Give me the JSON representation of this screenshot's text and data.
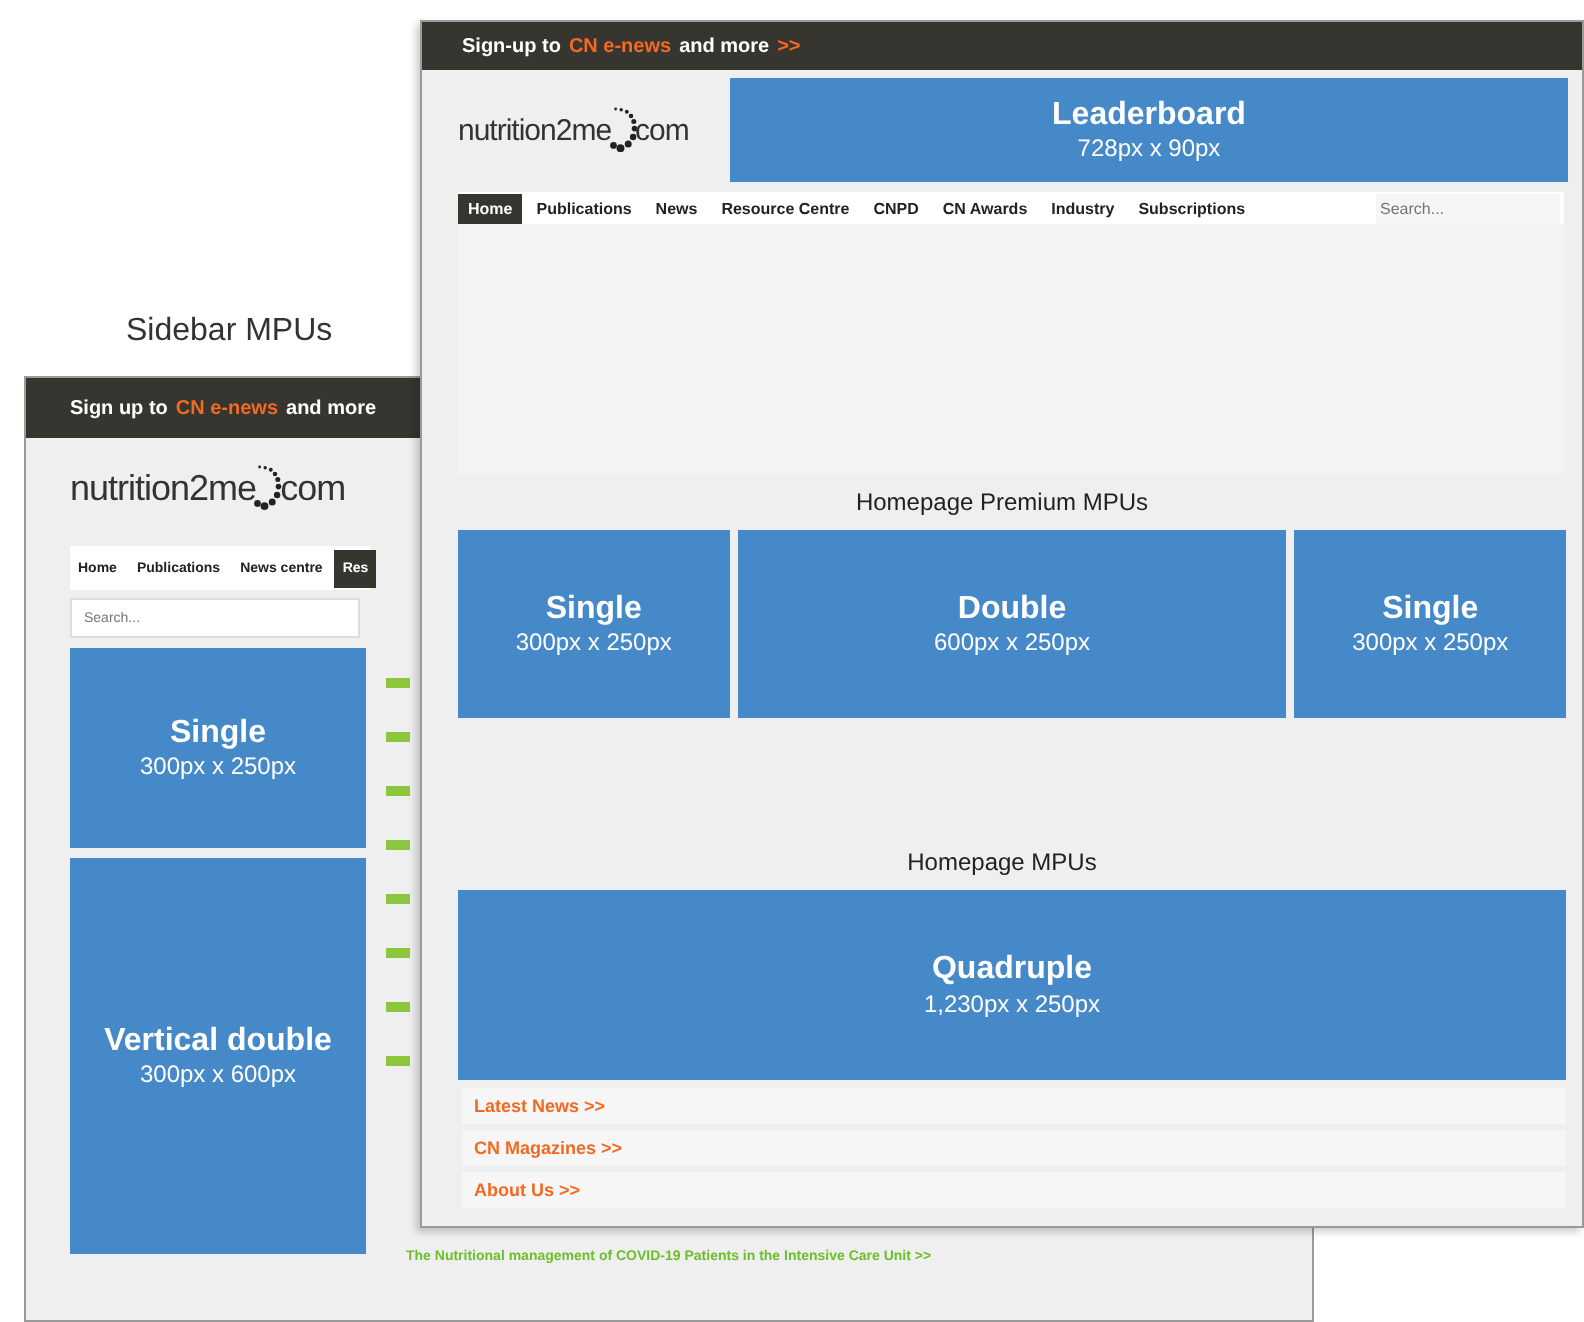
{
  "caption": "Sidebar MPUs",
  "sidebar_page": {
    "top_bar": {
      "lead": "Sign up to",
      "highlight": "CN e-news",
      "tail": "and more"
    },
    "logo": {
      "name": "nutrition2me",
      "suffix": "com"
    },
    "nav": [
      {
        "label": "Home",
        "selected": false
      },
      {
        "label": "Publications",
        "selected": false
      },
      {
        "label": "News centre",
        "selected": false
      },
      {
        "label": "Res",
        "selected": true
      }
    ],
    "search": {
      "placeholder": "Search..."
    },
    "ads": [
      {
        "title": "Single",
        "size": "300px x 250px",
        "kind": "single"
      },
      {
        "title": "Vertical double",
        "size": "300px x 600px",
        "kind": "tall"
      }
    ],
    "footer_link": "The Nutritional management of COVID-19 Patients in the Intensive Care Unit >>"
  },
  "homepage": {
    "top_bar": {
      "lead": "Sign-up to",
      "highlight": "CN e-news",
      "tail": "and more",
      "arrow": ">>"
    },
    "logo": {
      "name": "nutrition2me",
      "suffix": "com"
    },
    "leaderboard": {
      "title": "Leaderboard",
      "size": "728px x 90px"
    },
    "nav": [
      {
        "label": "Home",
        "selected": true
      },
      {
        "label": "Publications",
        "selected": false
      },
      {
        "label": "News",
        "selected": false
      },
      {
        "label": "Resource Centre",
        "selected": false
      },
      {
        "label": "CNPD",
        "selected": false
      },
      {
        "label": "CN Awards",
        "selected": false
      },
      {
        "label": "Industry",
        "selected": false
      },
      {
        "label": "Subscriptions",
        "selected": false
      }
    ],
    "search": {
      "placeholder": "Search..."
    },
    "premium_label": "Homepage Premium MPUs",
    "premium_ads": [
      {
        "title": "Single",
        "size": "300px x 250px",
        "kind": "single"
      },
      {
        "title": "Double",
        "size": "600px x 250px",
        "kind": "double"
      },
      {
        "title": "Single",
        "size": "300px x 250px",
        "kind": "single"
      }
    ],
    "mpu_label": "Homepage MPUs",
    "mpu_ad": {
      "title": "Quadruple",
      "size": "1,230px x 250px"
    },
    "links": [
      "Latest News >>",
      "CN Magazines >>",
      "About Us >>"
    ]
  }
}
